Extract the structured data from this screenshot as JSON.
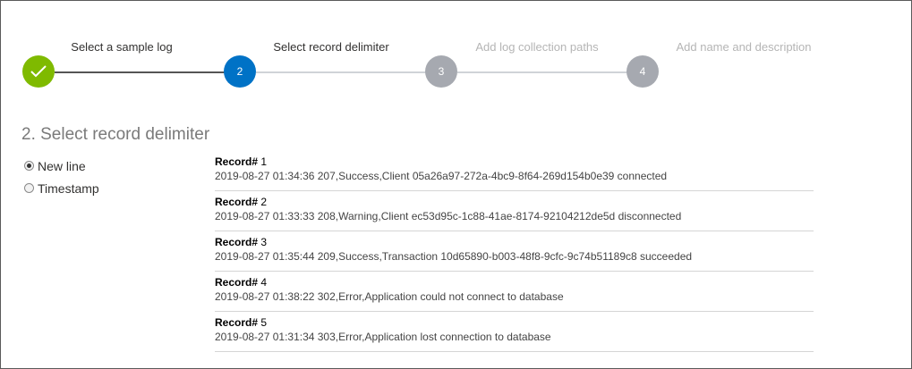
{
  "wizard": {
    "steps": [
      {
        "label": "Select a sample log",
        "number": "",
        "state": "completed",
        "icon": "checkmark-icon"
      },
      {
        "label": "Select record delimiter",
        "number": "2",
        "state": "current"
      },
      {
        "label": "Add log collection paths",
        "number": "3",
        "state": "future"
      },
      {
        "label": "Add name and description",
        "number": "4",
        "state": "future"
      }
    ],
    "colors": {
      "completed": "#7fba00",
      "current": "#0072c6",
      "future": "#a6a9b0",
      "line_done": "#555555",
      "line_pending": "#d0d3d8"
    }
  },
  "section": {
    "title": "2. Select record delimiter"
  },
  "delimiter_options": [
    {
      "label": "New line",
      "checked": true
    },
    {
      "label": "Timestamp",
      "checked": false
    }
  ],
  "records": [
    {
      "heading": "Record#",
      "number": "1",
      "text": "2019-08-27 01:34:36 207,Success,Client 05a26a97-272a-4bc9-8f64-269d154b0e39 connected"
    },
    {
      "heading": "Record#",
      "number": "2",
      "text": "2019-08-27 01:33:33 208,Warning,Client ec53d95c-1c88-41ae-8174-92104212de5d disconnected"
    },
    {
      "heading": "Record#",
      "number": "3",
      "text": "2019-08-27 01:35:44 209,Success,Transaction 10d65890-b003-48f8-9cfc-9c74b51189c8 succeeded"
    },
    {
      "heading": "Record#",
      "number": "4",
      "text": "2019-08-27 01:38:22 302,Error,Application could not connect to database"
    },
    {
      "heading": "Record#",
      "number": "5",
      "text": "2019-08-27 01:31:34 303,Error,Application lost connection to database"
    }
  ]
}
